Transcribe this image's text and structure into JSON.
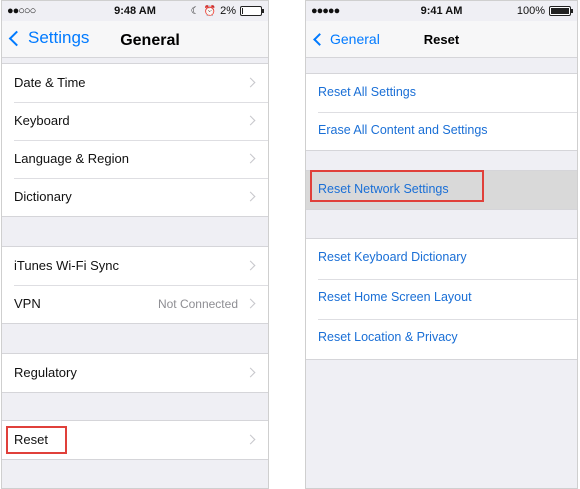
{
  "left_screen": {
    "status": {
      "signal": "●●○○○",
      "time": "9:48 AM",
      "battery": "2%",
      "battery_fraction": 0.02
    },
    "nav": {
      "back_label": "Settings",
      "title": "General"
    },
    "groups": [
      {
        "rows": [
          {
            "label": "Date & Time",
            "value": ""
          },
          {
            "label": "Keyboard",
            "value": ""
          },
          {
            "label": "Language & Region",
            "value": ""
          },
          {
            "label": "Dictionary",
            "value": ""
          }
        ]
      },
      {
        "rows": [
          {
            "label": "iTunes Wi-Fi Sync",
            "value": ""
          },
          {
            "label": "VPN",
            "value": "Not Connected"
          }
        ]
      },
      {
        "rows": [
          {
            "label": "Regulatory",
            "value": ""
          }
        ]
      },
      {
        "rows": [
          {
            "label": "Reset",
            "value": "",
            "highlighted": true
          }
        ]
      }
    ]
  },
  "right_screen": {
    "status": {
      "signal": "●●●●●",
      "time": "9:41 AM",
      "battery": "100%",
      "battery_fraction": 1.0
    },
    "nav": {
      "back_label": "General",
      "title": "Reset"
    },
    "groups": [
      {
        "rows": [
          {
            "label": "Reset All Settings"
          },
          {
            "label": "Erase All Content and Settings"
          }
        ]
      },
      {
        "rows": [
          {
            "label": "Reset Network Settings",
            "highlighted": true
          }
        ]
      },
      {
        "rows": [
          {
            "label": "Reset Keyboard Dictionary"
          },
          {
            "label": "Reset Home Screen Layout"
          },
          {
            "label": "Reset Location & Privacy"
          }
        ]
      }
    ]
  },
  "colors": {
    "accent": "#007aff",
    "action_text": "#1a6fd6",
    "highlight_border": "#e0403a",
    "highlight_row": "#d9d9d9"
  }
}
